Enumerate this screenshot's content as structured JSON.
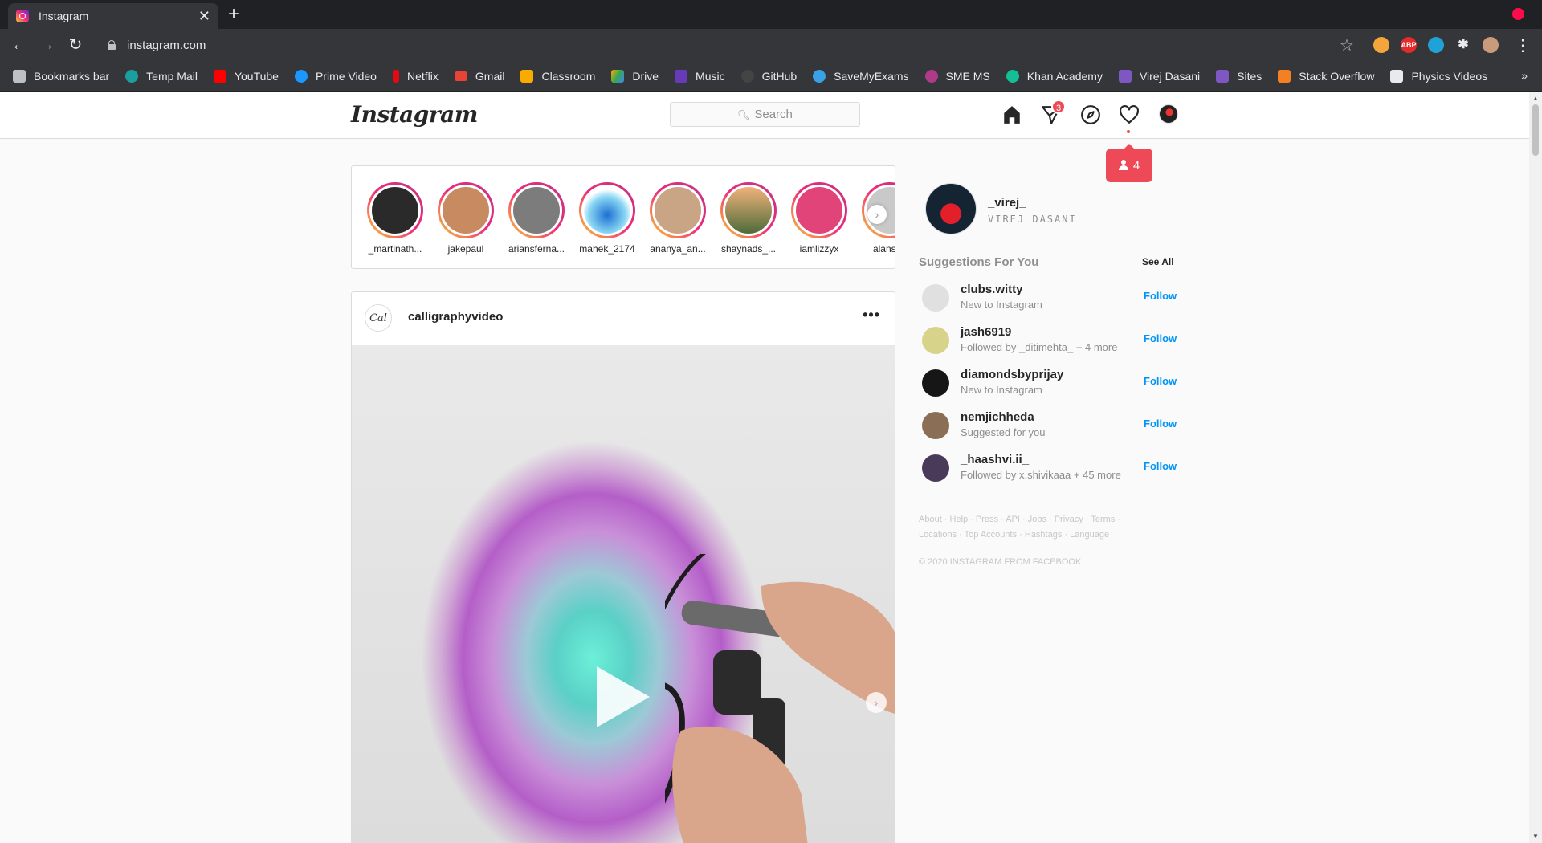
{
  "browser": {
    "tab_title": "Instagram",
    "url": "instagram.com",
    "bookmarks": [
      {
        "label": "Bookmarks bar",
        "icon": "folder-icon",
        "color": "#bdc1c6"
      },
      {
        "label": "Temp Mail",
        "icon": "mail-icon",
        "color": "#1a9e9e"
      },
      {
        "label": "YouTube",
        "icon": "youtube-icon",
        "color": "#ff0000"
      },
      {
        "label": "Prime Video",
        "icon": "prime-icon",
        "color": "#1a98ff"
      },
      {
        "label": "Netflix",
        "icon": "netflix-icon",
        "color": "#e50914"
      },
      {
        "label": "Gmail",
        "icon": "gmail-icon",
        "color": "#ea4335"
      },
      {
        "label": "Classroom",
        "icon": "classroom-icon",
        "color": "#f9ab00"
      },
      {
        "label": "Drive",
        "icon": "drive-icon",
        "color": "#34a853"
      },
      {
        "label": "Music",
        "icon": "music-icon",
        "color": "#673ab7"
      },
      {
        "label": "GitHub",
        "icon": "github-icon",
        "color": "#444444"
      },
      {
        "label": "SaveMyExams",
        "icon": "savemyexams-icon",
        "color": "#3aa0e8"
      },
      {
        "label": "SME MS",
        "icon": "sme-icon",
        "color": "#b03a8a"
      },
      {
        "label": "Khan Academy",
        "icon": "khan-icon",
        "color": "#14bf96"
      },
      {
        "label": "Virej Dasani",
        "icon": "sites-icon",
        "color": "#7e57c2"
      },
      {
        "label": "Sites",
        "icon": "sites-icon",
        "color": "#7e57c2"
      },
      {
        "label": "Stack Overflow",
        "icon": "stackoverflow-icon",
        "color": "#f48024"
      },
      {
        "label": "Physics Videos",
        "icon": "physics-icon",
        "color": "#e8eaed"
      }
    ],
    "bookmarks_more": "»",
    "extensions": [
      {
        "label": "",
        "color": "#f4a63a"
      },
      {
        "label": "ABP",
        "color": "#e52a2a"
      },
      {
        "label": "",
        "color": "#1fa3d7"
      }
    ]
  },
  "instagram": {
    "logo": "Instagram",
    "search_placeholder": "Search",
    "message_badge": "3",
    "activity_popup_count": "4",
    "stories": [
      {
        "name": "_martinath...",
        "color": "#2a2a2a"
      },
      {
        "name": "jakepaul",
        "color": "#c88a60"
      },
      {
        "name": "ariansferna...",
        "color": "#7c7c7c"
      },
      {
        "name": "mahek_2174",
        "color": "#5fb3e6"
      },
      {
        "name": "ananya_an...",
        "color": "#caa585"
      },
      {
        "name": "shaynads_...",
        "color": "#6b5a3f"
      },
      {
        "name": "iamlizzyx",
        "color": "#e04478"
      },
      {
        "name": "alanshe",
        "color": "#c9c9c9"
      }
    ],
    "post": {
      "username": "calligraphyvideo",
      "avatar_text": "Cal",
      "more": "•••"
    },
    "profile": {
      "username": "_virej_",
      "full_name": "VIREJ DASANI"
    },
    "suggestions_title": "Suggestions For You",
    "see_all": "See All",
    "follow_label": "Follow",
    "suggestions": [
      {
        "username": "clubs.witty",
        "subtitle": "New to Instagram",
        "color": "#e0e0e0"
      },
      {
        "username": "jash6919",
        "subtitle": "Followed by _ditimehta_ + 4 more",
        "color": "#d7d38a"
      },
      {
        "username": "diamondsbyprijay",
        "subtitle": "New to Instagram",
        "color": "#161616"
      },
      {
        "username": "nemjichheda",
        "subtitle": "Suggested for you",
        "color": "#8a6e55"
      },
      {
        "username": "_haashvi.ii_",
        "subtitle": "Followed by x.shivikaaa + 45 more",
        "color": "#4a3a5a"
      }
    ],
    "footer_line1": "About · Help · Press · API · Jobs · Privacy · Terms ·",
    "footer_line2": "Locations · Top Accounts · Hashtags · Language",
    "copyright": "© 2020 INSTAGRAM FROM FACEBOOK"
  }
}
